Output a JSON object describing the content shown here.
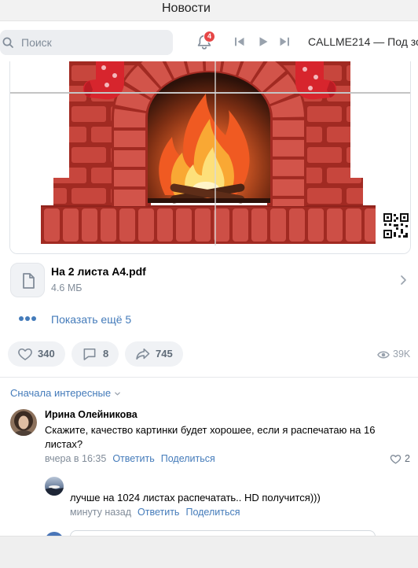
{
  "window": {
    "title": "Новости"
  },
  "header": {
    "search_placeholder": "Поиск",
    "notifications_badge": "4",
    "player_track": "CALLME214 — Под зо"
  },
  "post": {
    "attachment": {
      "name": "На 2 листа А4.pdf",
      "size": "4.6 МБ",
      "icon": "document-icon"
    },
    "show_more_label": "Показать ещё 5",
    "actions": {
      "likes": "340",
      "comments": "8",
      "shares": "745",
      "views": "39K"
    }
  },
  "comments": {
    "sort_label": "Сначала интересные",
    "items": [
      {
        "author": "Ирина Олейникова",
        "text": "Скажите, качество картинки будет хорошее, если я распечатаю на 16 листах?",
        "time": "вчера в 16:35",
        "reply_label": "Ответить",
        "share_label": "Поделиться",
        "likes": "2",
        "replies": [
          {
            "text": "лучше на 1024 листах распечатать.. HD получится)))",
            "time": "минуту назад",
            "reply_label": "Ответить",
            "share_label": "Поделиться"
          }
        ]
      }
    ]
  },
  "colors": {
    "link": "#447bba",
    "muted": "#818c99",
    "badge": "#e64646",
    "pill_bg": "#f0f2f5",
    "text": "#000000"
  }
}
